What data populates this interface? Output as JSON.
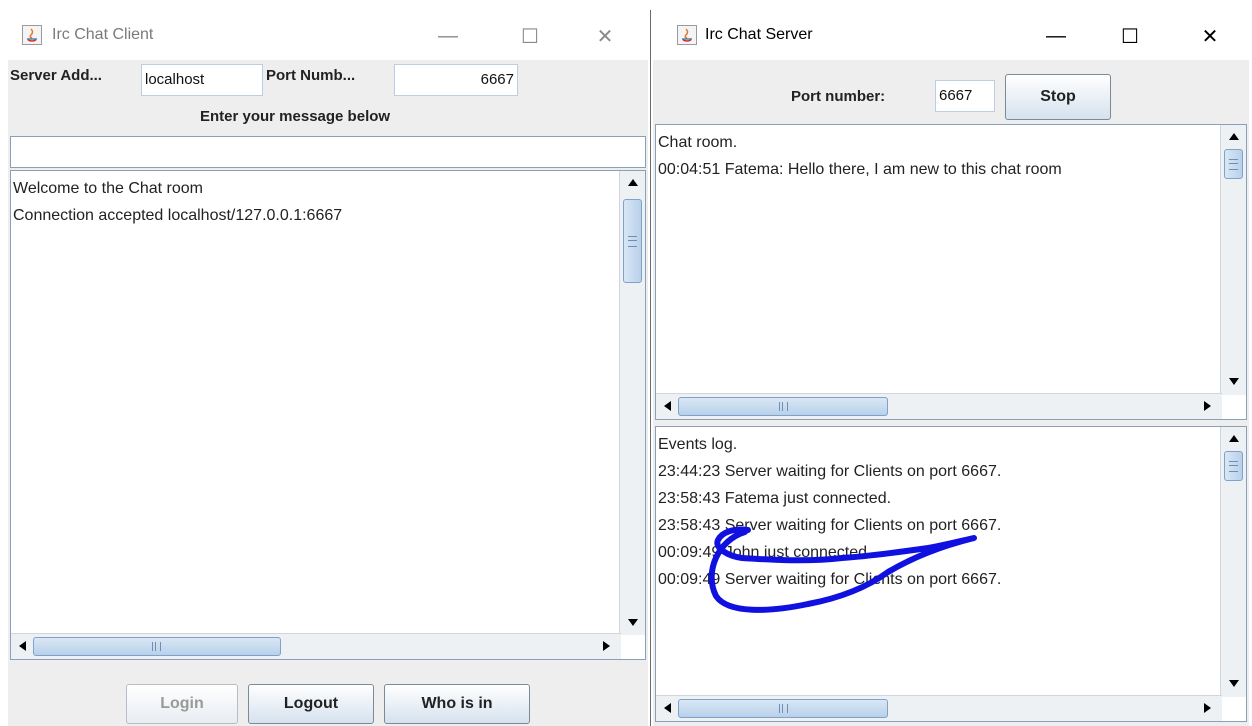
{
  "client": {
    "title": "Irc Chat Client",
    "server_label": "Server Add...",
    "server_value": "localhost",
    "port_label": "Port Numb...",
    "port_value": "6667",
    "prompt": "Enter your message below",
    "message_value": "",
    "chat_lines": [
      "Welcome to the Chat room",
      "Connection accepted localhost/127.0.0.1:6667"
    ],
    "buttons": {
      "login": "Login",
      "logout": "Logout",
      "whoisin": "Who is in"
    }
  },
  "server": {
    "title": "Irc Chat Server",
    "port_label": "Port number:",
    "port_value": "6667",
    "stop_label": "Stop",
    "chat_lines": [
      "Chat room.",
      "00:04:51 Fatema: Hello there, I am new to this chat room"
    ],
    "event_lines": [
      "Events log.",
      "23:44:23 Server waiting for Clients on port 6667.",
      "23:58:43 Fatema just connected.",
      "23:58:43 Server waiting for Clients on port 6667.",
      "00:09:49 John just connected.",
      "00:09:49 Server waiting for Clients on port 6667."
    ]
  },
  "window_controls": {
    "minimize": "—",
    "maximize": "☐",
    "close": "✕"
  },
  "colors": {
    "annotation_stroke": "#1010e0",
    "thumb": "#b9d0ea",
    "panel_bg": "#eeeeee"
  }
}
